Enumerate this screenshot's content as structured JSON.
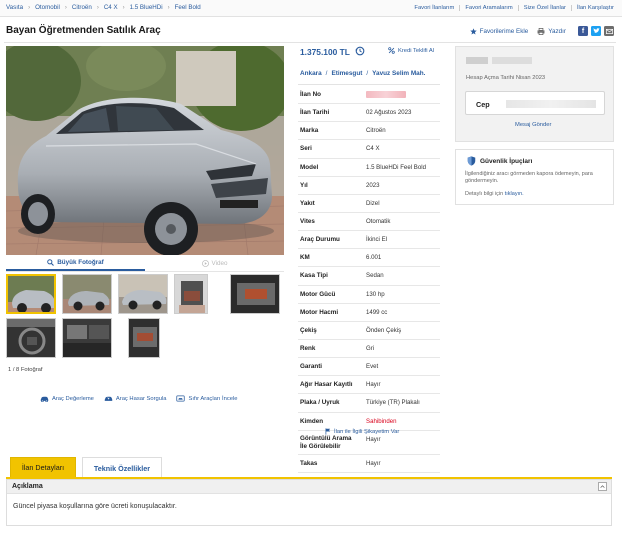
{
  "breadcrumb": [
    "Vasıta",
    "Otomobil",
    "Citroën",
    "C4 X",
    "1.5 BlueHDi",
    "Feel Bold"
  ],
  "top_links": [
    "Favori İlanlarım",
    "Favori Aramalarım",
    "Size Özel İlanlar",
    "İlan Karşılaştır"
  ],
  "listing_title": "Bayan Öğretmenden Satılık Araç",
  "actions": {
    "favorite": "Favorilerime Ekle",
    "print": "Yazdır"
  },
  "price": "1.375.100 TL",
  "credit_offer": "Kredi Teklifi Al",
  "location": [
    "Ankara",
    "Etimesgut",
    "Yavuz Selim Mah."
  ],
  "photo_tabs": {
    "large_photo": "Büyük Fotoğraf",
    "video": "Video"
  },
  "photo_count": "1 / 8 Fotoğraf",
  "tools": [
    "Araç Değerleme",
    "Araç Hasar Sorgula",
    "Sıfır Araçları İncele"
  ],
  "specs": [
    {
      "key": "İlan No",
      "value": ""
    },
    {
      "key": "İlan Tarihi",
      "value": "02 Ağustos 2023"
    },
    {
      "key": "Marka",
      "value": "Citroën"
    },
    {
      "key": "Seri",
      "value": "C4 X"
    },
    {
      "key": "Model",
      "value": "1.5 BlueHDi Feel Bold"
    },
    {
      "key": "Yıl",
      "value": "2023"
    },
    {
      "key": "Yakıt",
      "value": "Dizel"
    },
    {
      "key": "Vites",
      "value": "Otomatik"
    },
    {
      "key": "Araç Durumu",
      "value": "İkinci El"
    },
    {
      "key": "KM",
      "value": "6.001"
    },
    {
      "key": "Kasa Tipi",
      "value": "Sedan"
    },
    {
      "key": "Motor Gücü",
      "value": "130 hp"
    },
    {
      "key": "Motor Hacmi",
      "value": "1499 cc"
    },
    {
      "key": "Çekiş",
      "value": "Önden Çekiş"
    },
    {
      "key": "Renk",
      "value": "Gri"
    },
    {
      "key": "Garanti",
      "value": "Evet"
    },
    {
      "key": "Ağır Hasar Kayıtlı",
      "value": "Hayır"
    },
    {
      "key": "Plaka / Uyruk",
      "value": "Türkiye (TR) Plakalı"
    },
    {
      "key": "Kimden",
      "value": "Sahibinden"
    },
    {
      "key": "Görüntülü Arama İle Görülebilir",
      "value": "Hayır"
    },
    {
      "key": "Takas",
      "value": "Hayır"
    }
  ],
  "report_link": "İlan ile İlgili Şikayetim Var",
  "seller": {
    "account_since": "Hesap Açma Tarihi  Nisan 2023",
    "phone_label": "Cep",
    "message": "Mesaj Gönder"
  },
  "safety": {
    "title": "Güvenlik İpuçları",
    "body": "İlgilendiğiniz aracı görmeden kapora ödemeyin, para göndermeyin.",
    "more_prefix": "Detaylı bilgi için",
    "more_link": "tıklayın."
  },
  "detail_tabs": {
    "active": "İlan Detayları",
    "inactive": "Teknik Özellikler"
  },
  "description": {
    "heading": "Açıklama",
    "text": "Güncel piyasa koşullarına göre ücreti konuşulacaktır."
  },
  "colors": {
    "accent_blue": "#2a5c9e",
    "tab_yellow": "#f1c300",
    "seller_red": "#d9001b"
  }
}
